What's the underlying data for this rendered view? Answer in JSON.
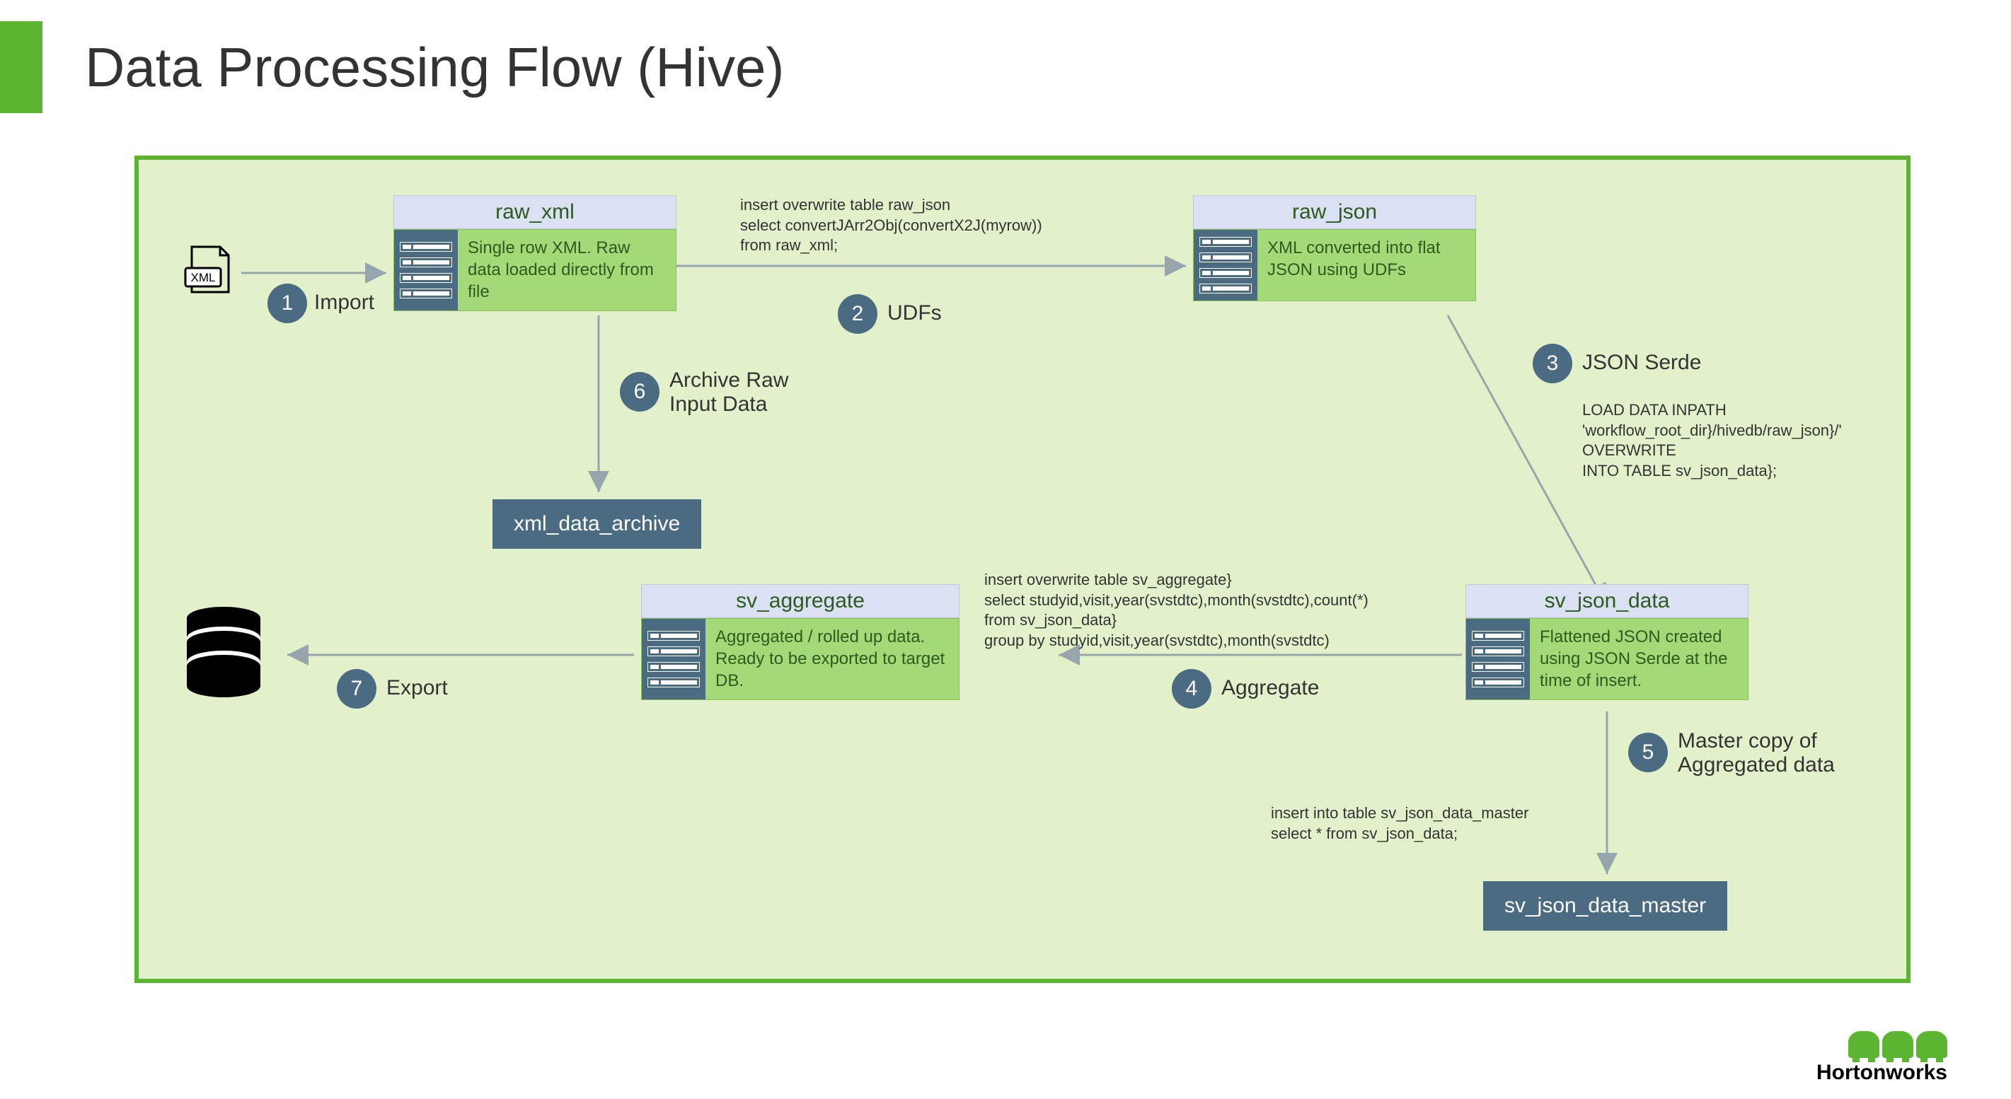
{
  "title": "Data Processing Flow (Hive)",
  "tables": {
    "raw_xml": {
      "name": "raw_xml",
      "desc": "Single row XML. Raw data loaded directly from file"
    },
    "raw_json": {
      "name": "raw_json",
      "desc": "XML converted into flat JSON using UDFs"
    },
    "sv_json_data": {
      "name": "sv_json_data",
      "desc": "Flattened JSON created using JSON Serde at the time of insert."
    },
    "sv_aggregate": {
      "name": "sv_aggregate",
      "desc": "Aggregated / rolled up data. Ready to be exported to target DB."
    }
  },
  "archives": {
    "xml_data_archive": "xml_data_archive",
    "sv_json_data_master": "sv_json_data_master"
  },
  "steps": {
    "s1": {
      "num": "1",
      "label": "Import"
    },
    "s2": {
      "num": "2",
      "label": "UDFs"
    },
    "s3": {
      "num": "3",
      "label": "JSON Serde"
    },
    "s4": {
      "num": "4",
      "label": "Aggregate"
    },
    "s5": {
      "num": "5",
      "label": "Master copy of\nAggregated data"
    },
    "s6": {
      "num": "6",
      "label": "Archive Raw\nInput Data"
    },
    "s7": {
      "num": "7",
      "label": "Export"
    }
  },
  "code": {
    "c2": "insert overwrite table raw_json\nselect convertJArr2Obj(convertX2J(myrow))\nfrom raw_xml;",
    "c3": "LOAD DATA INPATH\n'workflow_root_dir}/hivedb/raw_json}/'\nOVERWRITE\nINTO TABLE sv_json_data};",
    "c4": "insert overwrite table sv_aggregate}\nselect studyid,visit,year(svstdtc),month(svstdtc),count(*)\nfrom sv_json_data}\ngroup by studyid,visit,year(svstdtc),month(svstdtc)",
    "c5": "insert into table sv_json_data_master\nselect * from sv_json_data;"
  },
  "logo": "Hortonworks",
  "xml_label": "XML"
}
